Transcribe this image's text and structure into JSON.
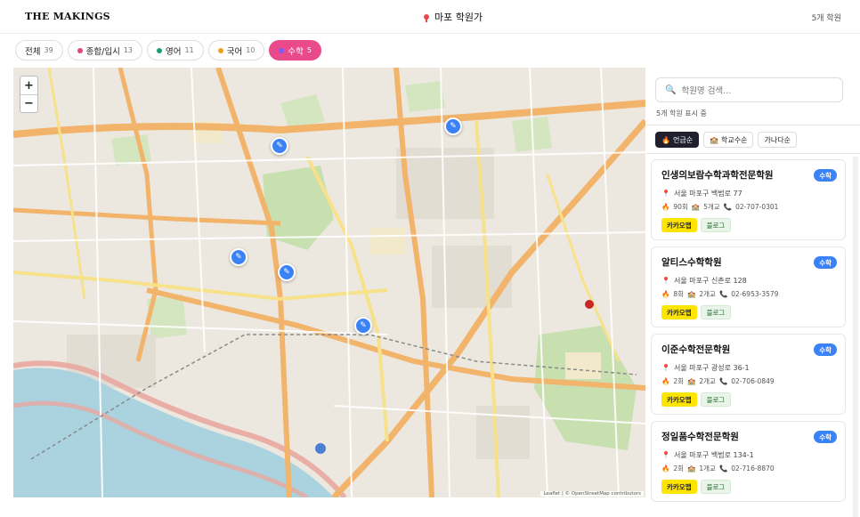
{
  "header": {
    "logo": "THE MAKINGS",
    "title": "마포 학원가",
    "count": "5개 학원"
  },
  "filters": [
    {
      "label": "전체",
      "count": "39",
      "dot": null,
      "active": false
    },
    {
      "label": "종합/입시",
      "count": "13",
      "dot": "#e0457b",
      "active": false
    },
    {
      "label": "영어",
      "count": "11",
      "dot": "#1aa06b",
      "active": false
    },
    {
      "label": "국어",
      "count": "10",
      "dot": "#f0a020",
      "active": false
    },
    {
      "label": "수학",
      "count": "5",
      "dot": "#7b5cf6",
      "active": true
    }
  ],
  "map": {
    "zoom_in": "+",
    "zoom_out": "−",
    "attribution": "Leaflet | © OpenStreetMap contributors",
    "marker_count": 5
  },
  "sidebar": {
    "search_placeholder": "학원명 검색...",
    "showing": "5개 학원 표시 중",
    "sorts": [
      {
        "label": "언급순",
        "icon": "🔥",
        "active": true
      },
      {
        "label": "학교수순",
        "icon": "🏫",
        "active": false
      },
      {
        "label": "가나다순",
        "icon": "",
        "active": false
      }
    ],
    "cards": [
      {
        "name": "인생의보람수학과학전문학원",
        "badge": "수학",
        "address": "서울 마포구 백범로 77",
        "mentions": "90회",
        "schools": "5개교",
        "phone": "02-707-0301",
        "kakao": "카카오맵",
        "blog": "블로그"
      },
      {
        "name": "알티스수학학원",
        "badge": "수학",
        "address": "서울 마포구 신촌로 128",
        "mentions": "8회",
        "schools": "2개교",
        "phone": "02-6953-3579",
        "kakao": "카카오맵",
        "blog": "블로그"
      },
      {
        "name": "이준수학전문학원",
        "badge": "수학",
        "address": "서울 마포구 광성로 36-1",
        "mentions": "2회",
        "schools": "2개교",
        "phone": "02-706-0849",
        "kakao": "카카오맵",
        "blog": "블로그"
      },
      {
        "name": "정일품수학전문학원",
        "badge": "수학",
        "address": "서울 마포구 백범로 134-1",
        "mentions": "2회",
        "schools": "1개교",
        "phone": "02-716-8870",
        "kakao": "카카오맵",
        "blog": "블로그"
      }
    ]
  },
  "colors": {
    "accent_pink": "#e84a8c",
    "marker_blue": "#3b82f6",
    "kakao_yellow": "#fee500"
  }
}
